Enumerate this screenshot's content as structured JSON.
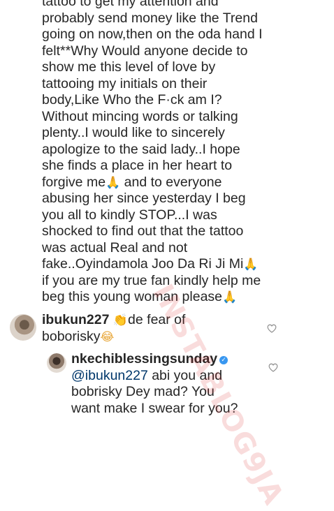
{
  "caption": {
    "lines": [
      "tattoo to get my attention and",
      "probably send money like the Trend",
      "going on now,then on the oda hand I",
      "felt**Why Would anyone decide to",
      "show me this level of love by",
      "tattooing my initials on their",
      "body,Like Who the F·ck am I?",
      "Without mincing words or talking",
      "plenty..I would like to sincerely",
      "apologize to the said lady..I hope",
      "she finds a place in her heart to",
      "forgive me",
      " and to everyone",
      "abusing her since yesterday I beg",
      "you all to kindly STOP...I was",
      "shocked to find out that the tattoo",
      "was actual Real and not",
      "fake..Oyindamola Joo Da Ri Ji Mi",
      "if you are my true fan kindly help me",
      "beg this young woman please"
    ]
  },
  "comments": [
    {
      "username": "ibukun227",
      "text_line1": "de fear of",
      "text_line2": "boborisky"
    },
    {
      "username": "nkechiblessingsunday",
      "mention": "@ibukun227",
      "text_line1": " abi you and",
      "text_line2": "bobrisky Dey mad? You",
      "text_line3": "want make I swear for you?"
    }
  ],
  "icons": {
    "pray": "folded-hands-icon",
    "clap": "clapping-hands-icon",
    "laugh": "tears-of-joy-icon",
    "heart": "heart-outline-icon",
    "verified": "verified-badge-icon"
  },
  "colors": {
    "text": "#262626",
    "mention": "#00376b",
    "verified": "#3897f0",
    "watermark": "#dc2828"
  }
}
